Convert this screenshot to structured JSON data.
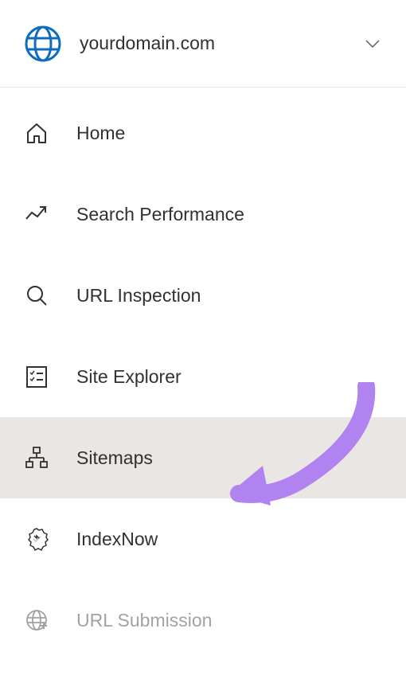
{
  "header": {
    "domain": "yourdomain.com"
  },
  "nav": {
    "items": [
      {
        "label": "Home"
      },
      {
        "label": "Search Performance"
      },
      {
        "label": "URL Inspection"
      },
      {
        "label": "Site Explorer"
      },
      {
        "label": "Sitemaps"
      },
      {
        "label": "IndexNow"
      },
      {
        "label": "URL Submission"
      }
    ]
  }
}
